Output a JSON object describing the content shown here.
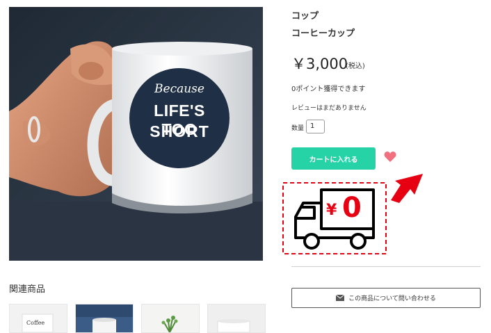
{
  "product": {
    "category": "コップ",
    "name": "コーヒーカップ",
    "price": "￥3,000",
    "tax_note": "(税込)",
    "points_text": "0ポイント獲得できます",
    "review_text": "レビューはまだありません",
    "quantity_label": "数量",
    "quantity_value": "1",
    "add_to_cart_label": "カートに入れる",
    "contact_label": "この商品について問い合わせる"
  },
  "mug_print": {
    "line1": "Because",
    "line2": "LIFE'S TOO",
    "line3": "SHORT"
  },
  "shipping_badge": {
    "yen_symbol": "¥",
    "amount": "0"
  },
  "related": {
    "title": "関連商品",
    "thumb1_text": "Coffee"
  },
  "colors": {
    "cart_button": "#25d3a6",
    "favorite_heart": "#f0707f",
    "badge_red": "#e60012"
  },
  "icons": [
    "heart-icon",
    "envelope-icon",
    "truck-icon",
    "arrow-icon"
  ]
}
